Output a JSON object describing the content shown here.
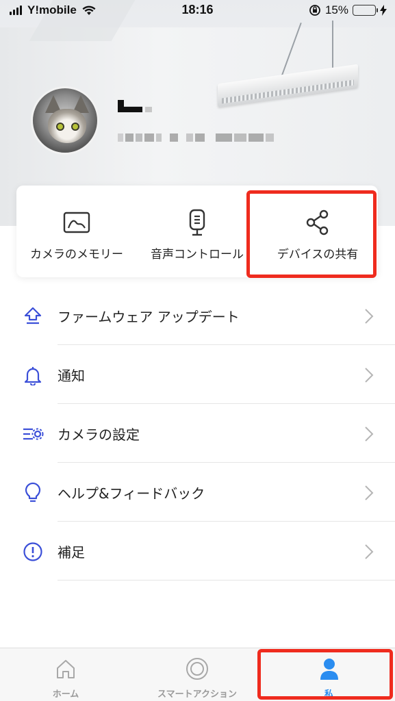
{
  "status_bar": {
    "carrier": "Y!mobile",
    "time": "18:16",
    "battery_percent": "15%",
    "battery_level": 0.15
  },
  "features": [
    {
      "label": "カメラのメモリー",
      "icon": "image-frame-icon"
    },
    {
      "label": "音声コントロール",
      "icon": "smart-speaker-icon"
    },
    {
      "label": "デバイスの共有",
      "icon": "share-icon"
    }
  ],
  "menu": [
    {
      "label": "ファームウェア アップデート",
      "icon": "firmware-update-icon"
    },
    {
      "label": "通知",
      "icon": "bell-icon"
    },
    {
      "label": "カメラの設定",
      "icon": "camera-settings-icon"
    },
    {
      "label": "ヘルプ&フィードバック",
      "icon": "lightbulb-icon"
    },
    {
      "label": "補足",
      "icon": "info-icon"
    }
  ],
  "tabs": [
    {
      "label": "ホーム",
      "icon": "home-icon",
      "active": false
    },
    {
      "label": "スマートアクション",
      "icon": "target-icon",
      "active": false
    },
    {
      "label": "私",
      "icon": "person-icon",
      "active": true
    }
  ],
  "colors": {
    "accent": "#2b8df0",
    "icon_blue": "#3b4fd8",
    "highlight_red": "#ef2b1e"
  }
}
